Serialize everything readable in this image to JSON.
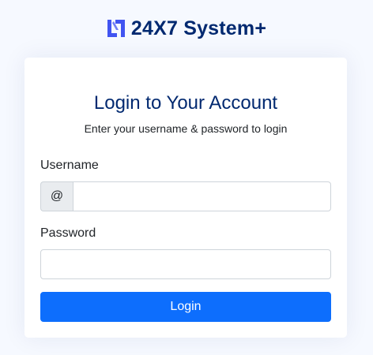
{
  "brand": {
    "name": "24X7 System+",
    "logo_icon": "brand-logo-icon",
    "color": "#012970",
    "logo_color": "#4154f1"
  },
  "login_card": {
    "title": "Login to Your Account",
    "subtitle": "Enter your username & password to login",
    "username": {
      "label": "Username",
      "prefix": "@",
      "value": "",
      "placeholder": ""
    },
    "password": {
      "label": "Password",
      "value": "",
      "placeholder": ""
    },
    "submit_label": "Login"
  },
  "colors": {
    "page_background": "#f6f9ff",
    "primary_button": "#0d6efd",
    "title": "#012970"
  }
}
